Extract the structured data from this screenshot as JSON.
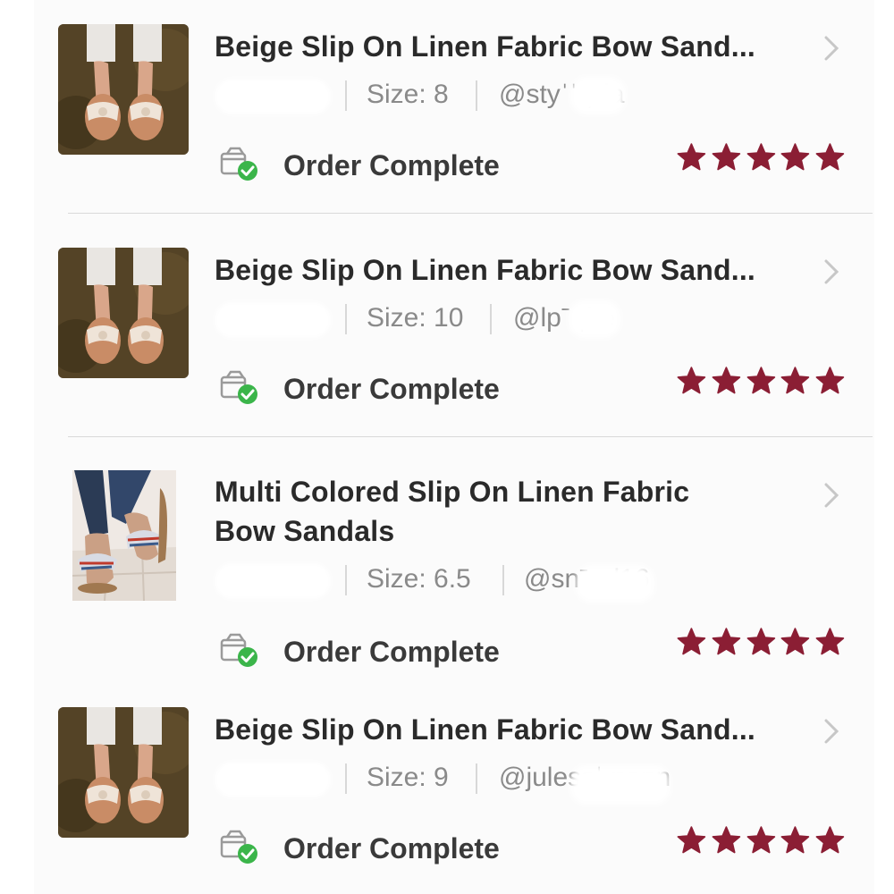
{
  "orders": [
    {
      "title": "Beige Slip On Linen Fabric Bow Sand...",
      "size": "Size: 8",
      "user": "@styˈˈ   ˏda",
      "status": "Order Complete",
      "rating": 5,
      "thumb": "beige-sandals"
    },
    {
      "title": "Beige Slip On Linen Fabric Bow Sand...",
      "size": "Size: 10",
      "user": "@lpˉ  ˌke",
      "status": "Order Complete",
      "rating": 5,
      "thumb": "beige-sandals"
    },
    {
      "title_line1": "Multi Colored Slip On Linen Fabric",
      "title_line2": "Bow Sandals",
      "size": "Size: 6.5",
      "user": "@snˉ     ˏd16",
      "status": "Order Complete",
      "rating": 5,
      "thumb": "multi-colored-sandals"
    },
    {
      "title": "Beige Slip On Linen Fabric Bow Sand...",
      "size": "Size: 9",
      "user": "@julessˈ         nann",
      "status": "Order Complete",
      "rating": 5,
      "thumb": "beige-sandals"
    }
  ],
  "colors": {
    "star": "#8b1e34",
    "status_check": "#3bb54a",
    "divider": "#d9d9d9"
  }
}
